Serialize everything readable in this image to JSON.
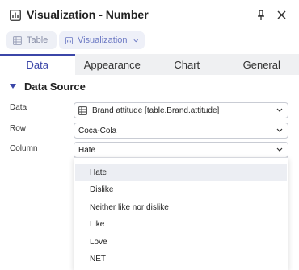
{
  "header": {
    "title": "Visualization - Number"
  },
  "breadcrumbs": [
    {
      "label": "Table"
    },
    {
      "label": "Visualization"
    }
  ],
  "tabs": [
    {
      "label": "Data",
      "active": true
    },
    {
      "label": "Appearance",
      "active": false
    },
    {
      "label": "Chart",
      "active": false
    },
    {
      "label": "General",
      "active": false
    }
  ],
  "section": {
    "title": "Data Source"
  },
  "fields": {
    "data": {
      "label": "Data",
      "value": "Brand attitude [table.Brand.attitude]"
    },
    "row": {
      "label": "Row",
      "value": "Coca-Cola"
    },
    "column": {
      "label": "Column",
      "value": "Hate"
    }
  },
  "dropdown": {
    "options": [
      "Hate",
      "Dislike",
      "Neither like nor dislike",
      "Like",
      "Love",
      "NET"
    ],
    "highlighted": "Hate"
  },
  "colors": {
    "accent": "#3b46a8",
    "tab_bar": "#eff0f2",
    "chip_bg": "#eef0f6"
  }
}
